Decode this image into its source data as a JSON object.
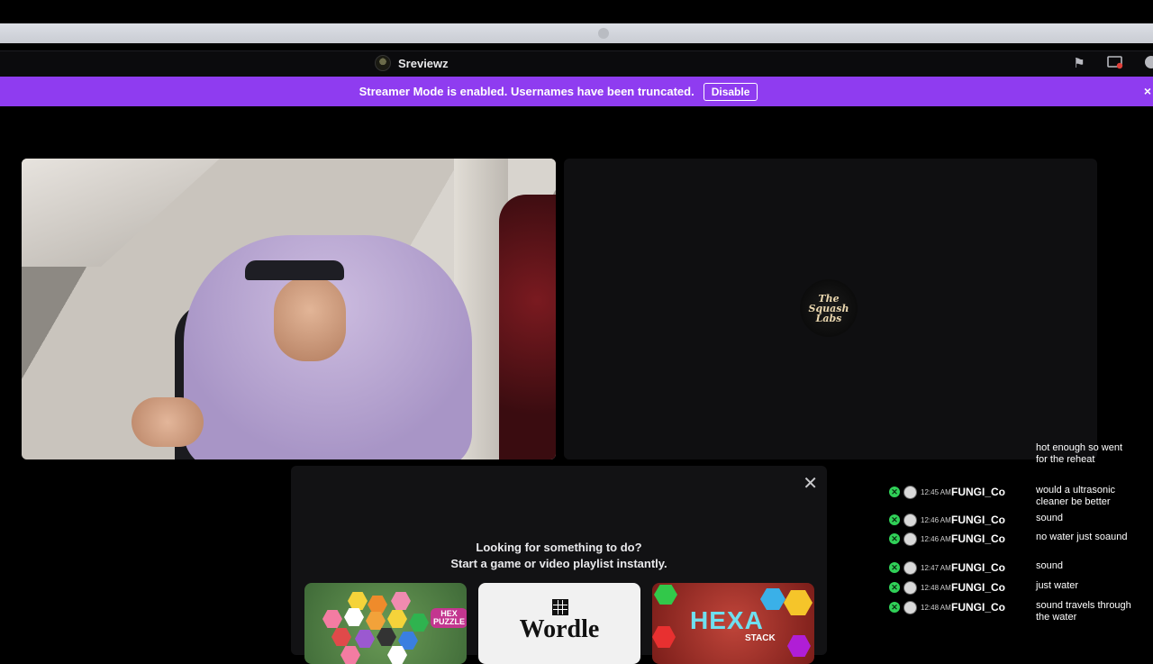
{
  "header": {
    "username": "Sreviewz"
  },
  "banner": {
    "message": "Streamer Mode is enabled. Usernames have been truncated.",
    "disable_label": "Disable",
    "close_glyph": "×",
    "color": "#8f3cf0"
  },
  "titlebar_icons": [
    "flag-icon",
    "screen-record-icon",
    "help-icon"
  ],
  "stream_logo": {
    "lines": [
      "The",
      "Squash",
      "Labs"
    ]
  },
  "activity": {
    "close_glyph": "✕",
    "heading_line1": "Looking for something to do?",
    "heading_line2": "Start a game or video playlist instantly.",
    "cards": [
      {
        "title": "HEX PUZZLE"
      },
      {
        "title": "Wordle"
      },
      {
        "title": "HEXA",
        "subtitle": "STACK"
      }
    ]
  },
  "chat": {
    "partial_message": "hot enough so went for the reheat",
    "messages": [
      {
        "time": "12:45 AM",
        "user": "FUNGI_Co",
        "text": "would a ultrasonic cleaner be better"
      },
      {
        "time": "12:46 AM",
        "user": "FUNGI_Co",
        "text": "sound"
      },
      {
        "time": "12:46 AM",
        "user": "FUNGI_Co",
        "text": "no water just soaund"
      },
      {
        "time": "12:47 AM",
        "user": "FUNGI_Co",
        "text": "sound"
      },
      {
        "time": "12:48 AM",
        "user": "FUNGI_Co",
        "text": "just water"
      },
      {
        "time": "12:48 AM",
        "user": "FUNGI_Co",
        "text": "sound travels through the water"
      }
    ]
  }
}
